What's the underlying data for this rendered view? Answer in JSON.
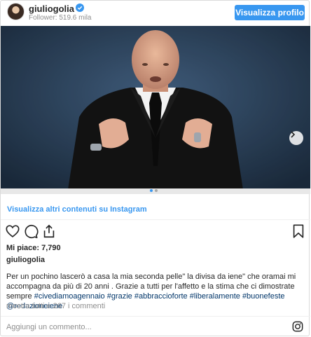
{
  "header": {
    "username": "giuliogolia",
    "followers": "Follower: 519.6 mila",
    "profile_button": "Visualizza profilo"
  },
  "more_link": "Visualizza altri contenuti su Instagram",
  "likes": "Mi piace: 7,790",
  "author": "giuliogolia",
  "caption": {
    "text": "Per un pochino lascerò a casa la mia seconda pelle\" la divisa da iene\" che oramai mi accompagna da più di 20 anni . Grazie a tutti per l'affetto e la stima che ci dimostrate sempre",
    "hashtags": "#civediamoagennaio #grazie #abbraccioforte #liberalamente #buonefeste @redazioneiene"
  },
  "comments_link": "mostra tutti e 267 i commenti",
  "comment_placeholder": "Aggiungi un commento...",
  "colors": {
    "accent": "#3897f0",
    "hashtag": "#003569",
    "muted": "#8e8e8e"
  },
  "icons": [
    "verified-badge-icon",
    "heart-icon",
    "comment-icon",
    "share-icon",
    "bookmark-icon",
    "instagram-logo-icon",
    "chevron-right-icon"
  ]
}
